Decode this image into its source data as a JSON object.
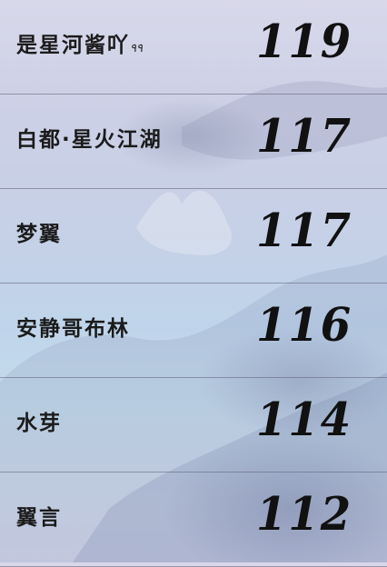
{
  "leaderboard": {
    "rows": [
      {
        "name": "是星河酱吖",
        "suffix": "٩٩",
        "score": "119"
      },
      {
        "name": "白都·星火江湖",
        "suffix": "",
        "score": "117"
      },
      {
        "name": "梦翼",
        "suffix": "",
        "score": "117"
      },
      {
        "name": "安静哥布林",
        "suffix": "",
        "score": "116"
      },
      {
        "name": "水芽",
        "suffix": "",
        "score": "114"
      },
      {
        "name": "翼言",
        "suffix": "",
        "score": "112"
      }
    ]
  }
}
